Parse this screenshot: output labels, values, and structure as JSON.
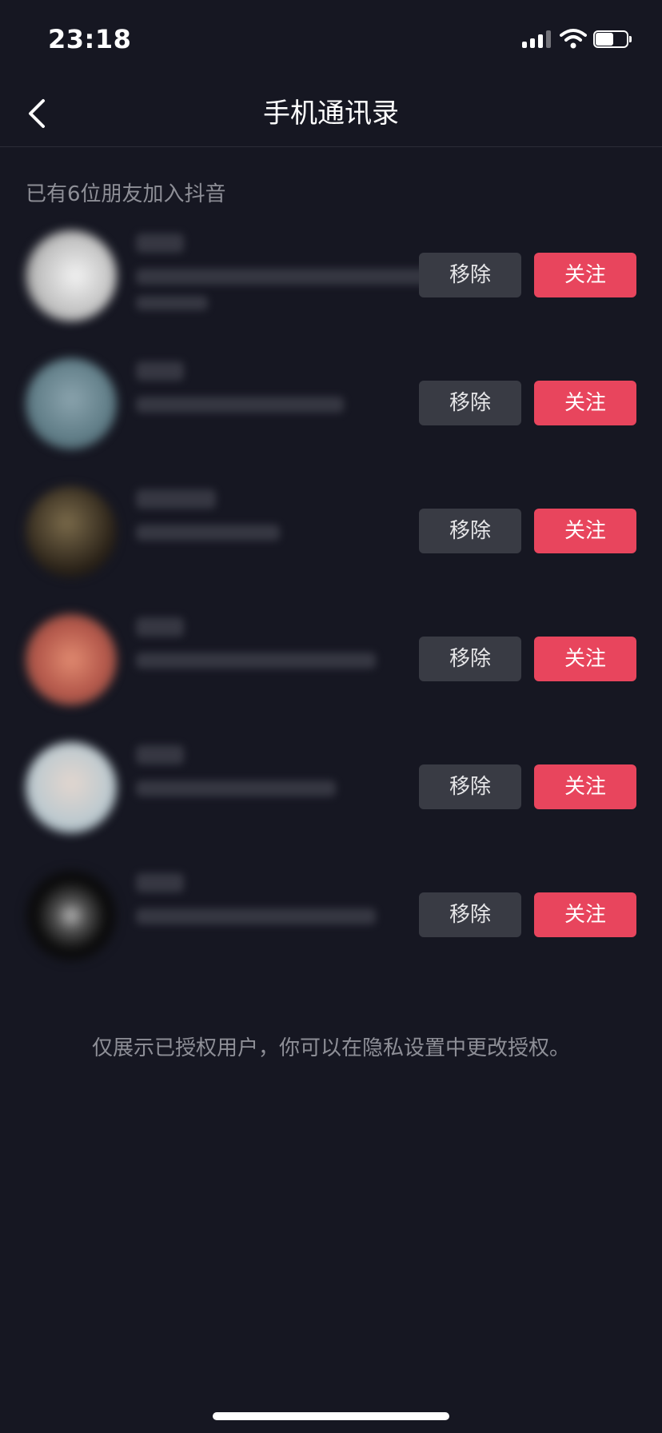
{
  "status_bar": {
    "time": "23:18"
  },
  "nav": {
    "title": "手机通讯录"
  },
  "subtitle": "已有6位朋友加入抖音",
  "contacts": [
    {
      "remove_label": "移除",
      "follow_label": "关注",
      "avatar_color": "#d9d9d9"
    },
    {
      "remove_label": "移除",
      "follow_label": "关注",
      "avatar_color": "#6f8b9a"
    },
    {
      "remove_label": "移除",
      "follow_label": "关注",
      "avatar_color": "#3a2d1e"
    },
    {
      "remove_label": "移除",
      "follow_label": "关注",
      "avatar_color": "#b06a55"
    },
    {
      "remove_label": "移除",
      "follow_label": "关注",
      "avatar_color": "#b9c4c9"
    },
    {
      "remove_label": "移除",
      "follow_label": "关注",
      "avatar_color": "#2a2a2a"
    }
  ],
  "footer_note": "仅展示已授权用户，你可以在隐私设置中更改授权。",
  "colors": {
    "background": "#161722",
    "follow": "#e8455d",
    "remove": "#393b44"
  }
}
